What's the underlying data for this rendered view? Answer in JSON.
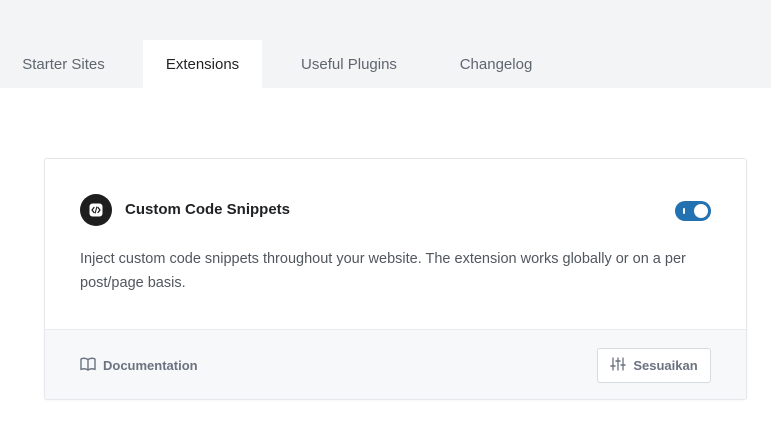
{
  "tabs": [
    {
      "label": "Starter Sites",
      "active": false
    },
    {
      "label": "Extensions",
      "active": true
    },
    {
      "label": "Useful Plugins",
      "active": false
    },
    {
      "label": "Changelog",
      "active": false
    }
  ],
  "extension": {
    "icon": "code-icon",
    "title": "Custom Code Snippets",
    "enabled": true,
    "description": "Inject custom code snippets throughout your website. The extension works globally or on a per post/page basis.",
    "documentation_label": "Documentation",
    "customize_label": "Sesuaikan"
  },
  "colors": {
    "accent": "#2271b1",
    "tabbar_bg": "#f3f4f5"
  }
}
